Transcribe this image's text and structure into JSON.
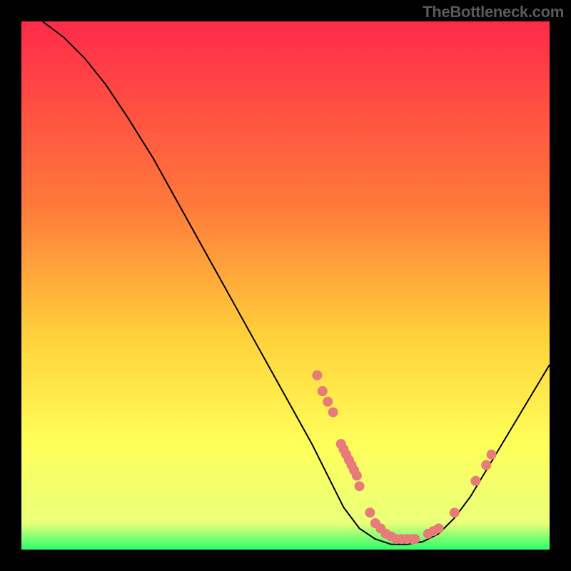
{
  "watermark": "TheBottleneck.com",
  "chart_data": {
    "type": "line",
    "title": "",
    "xlabel": "",
    "ylabel": "",
    "xlim": [
      0,
      100
    ],
    "ylim": [
      0,
      100
    ],
    "gradient_stops": [
      {
        "offset": 0,
        "color": "#ff2a4a"
      },
      {
        "offset": 35,
        "color": "#ff7a3a"
      },
      {
        "offset": 60,
        "color": "#ffd23a"
      },
      {
        "offset": 80,
        "color": "#ffff5a"
      },
      {
        "offset": 95,
        "color": "#eaff7a"
      },
      {
        "offset": 100,
        "color": "#2aff6a"
      }
    ],
    "curve": [
      {
        "x": 4,
        "y": 100
      },
      {
        "x": 8,
        "y": 97
      },
      {
        "x": 12,
        "y": 93
      },
      {
        "x": 16,
        "y": 88
      },
      {
        "x": 20,
        "y": 82
      },
      {
        "x": 25,
        "y": 74
      },
      {
        "x": 30,
        "y": 65
      },
      {
        "x": 35,
        "y": 56
      },
      {
        "x": 40,
        "y": 47
      },
      {
        "x": 45,
        "y": 38
      },
      {
        "x": 50,
        "y": 29
      },
      {
        "x": 55,
        "y": 20
      },
      {
        "x": 58,
        "y": 14
      },
      {
        "x": 61,
        "y": 8
      },
      {
        "x": 64,
        "y": 4
      },
      {
        "x": 67,
        "y": 2
      },
      {
        "x": 70,
        "y": 1
      },
      {
        "x": 73,
        "y": 1
      },
      {
        "x": 76,
        "y": 1.5
      },
      {
        "x": 79,
        "y": 3
      },
      {
        "x": 82,
        "y": 6
      },
      {
        "x": 85,
        "y": 10
      },
      {
        "x": 88,
        "y": 15
      },
      {
        "x": 91,
        "y": 20
      },
      {
        "x": 94,
        "y": 25
      },
      {
        "x": 97,
        "y": 30
      },
      {
        "x": 100,
        "y": 35
      }
    ],
    "points": [
      {
        "x": 56,
        "y": 33
      },
      {
        "x": 57,
        "y": 30
      },
      {
        "x": 58,
        "y": 28
      },
      {
        "x": 59,
        "y": 26
      },
      {
        "x": 60.5,
        "y": 20
      },
      {
        "x": 61,
        "y": 19
      },
      {
        "x": 61.5,
        "y": 18
      },
      {
        "x": 62,
        "y": 17
      },
      {
        "x": 62.5,
        "y": 16
      },
      {
        "x": 63,
        "y": 15
      },
      {
        "x": 63.5,
        "y": 14
      },
      {
        "x": 64,
        "y": 12
      },
      {
        "x": 66,
        "y": 7
      },
      {
        "x": 67,
        "y": 5
      },
      {
        "x": 68,
        "y": 4
      },
      {
        "x": 69,
        "y": 3
      },
      {
        "x": 70,
        "y": 2.5
      },
      {
        "x": 71,
        "y": 2
      },
      {
        "x": 72,
        "y": 2
      },
      {
        "x": 73,
        "y": 2
      },
      {
        "x": 74,
        "y": 2
      },
      {
        "x": 74.5,
        "y": 2
      },
      {
        "x": 77,
        "y": 3
      },
      {
        "x": 78,
        "y": 3.5
      },
      {
        "x": 79,
        "y": 4
      },
      {
        "x": 82,
        "y": 7
      },
      {
        "x": 86,
        "y": 13
      },
      {
        "x": 88,
        "y": 16
      },
      {
        "x": 89,
        "y": 18
      }
    ],
    "point_color": "#e87a7a",
    "curve_color": "#000000"
  }
}
